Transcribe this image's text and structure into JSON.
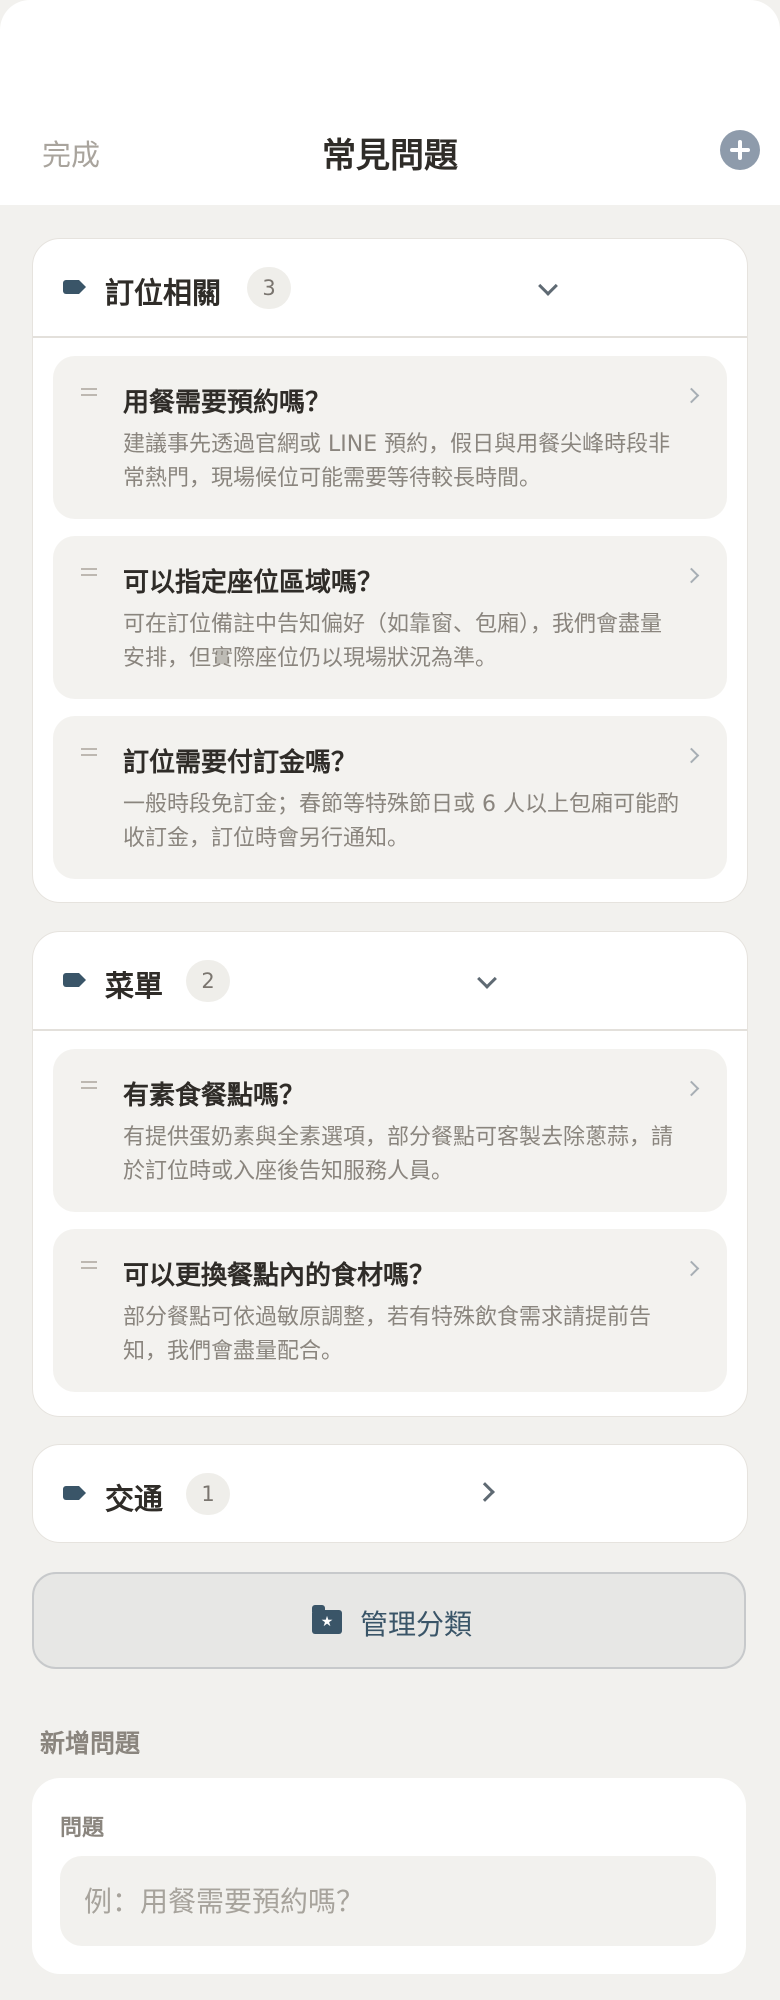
{
  "header": {
    "done_label": "完成",
    "title": "常見問題",
    "add_icon": "plus-circle-icon"
  },
  "categories": [
    {
      "name": "訂位相關",
      "count": "3",
      "expanded": true,
      "faqs": [
        {
          "question": "用餐需要預約嗎？",
          "answer": "建議事先透過官網或 LINE 預約，假日與用餐尖峰時段非常熱門，現場候位可能需要等待較長時間。"
        },
        {
          "question": "可以指定座位區域嗎？",
          "answer": "可在訂位備註中告知偏好（如靠窗、包廂），我們會盡量安排，但實際座位仍以現場狀況為準。"
        },
        {
          "question": "訂位需要付訂金嗎？",
          "answer": "一般時段免訂金；春節等特殊節日或 6 人以上包廂可能酌收訂金，訂位時會另行通知。"
        }
      ]
    },
    {
      "name": "菜單",
      "count": "2",
      "expanded": true,
      "faqs": [
        {
          "question": "有素食餐點嗎？",
          "answer": "有提供蛋奶素與全素選項，部分餐點可客製去除蔥蒜，請於訂位時或入座後告知服務人員。"
        },
        {
          "question": "可以更換餐點內的食材嗎？",
          "answer": "部分餐點可依過敏原調整，若有特殊飲食需求請提前告知，我們會盡量配合。"
        }
      ]
    },
    {
      "name": "交通",
      "count": "1",
      "expanded": false,
      "faqs": []
    }
  ],
  "manage": {
    "label": "管理分類",
    "icon": "folder-star-icon"
  },
  "new_question": {
    "section_title": "新增問題",
    "field_label": "問題",
    "placeholder": "例：用餐需要預約嗎？",
    "value": ""
  },
  "colors": {
    "accent": "#3a5568",
    "background": "#f2f1ee",
    "card": "#ffffff",
    "muted_text": "#8a857e"
  }
}
